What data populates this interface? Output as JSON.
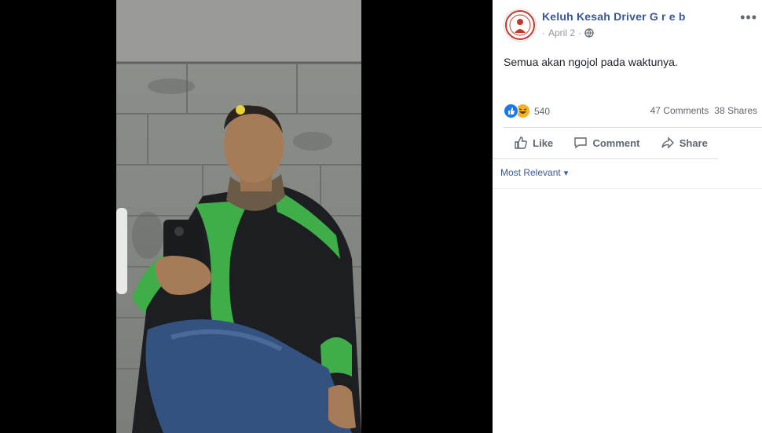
{
  "post": {
    "author": "Keluh Kesah Driver G r e b",
    "date": "April 2",
    "separator": "·",
    "text": "Semua akan ngojol pada waktunya.",
    "more_label": "•••"
  },
  "stats": {
    "reaction_count": "540",
    "comments": "47 Comments",
    "shares": "38 Shares"
  },
  "actions": {
    "like": "Like",
    "comment": "Comment",
    "share": "Share"
  },
  "comments_filter": {
    "label": "Most Relevant",
    "caret": "▾"
  },
  "colors": {
    "link": "#365899",
    "like_blue": "#1877f2",
    "haha_yellow": "#f7b125"
  },
  "icons": [
    "globe-icon",
    "like-reaction-icon",
    "haha-reaction-icon",
    "thumbs-up-icon",
    "comment-icon",
    "share-arrow-icon",
    "more-options-icon",
    "dropdown-caret-icon"
  ]
}
